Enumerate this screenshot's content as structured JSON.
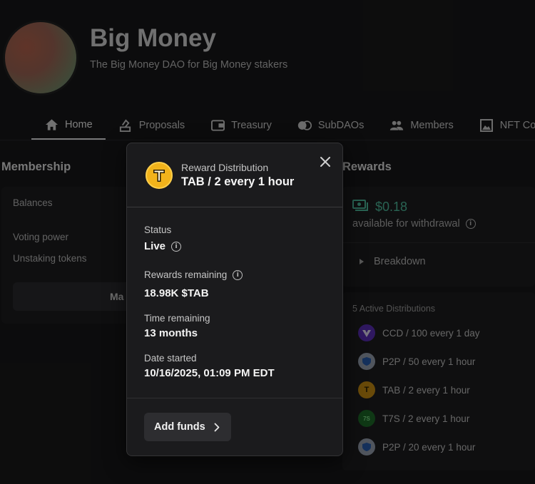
{
  "dao": {
    "name": "Big Money",
    "description": "The Big Money DAO for Big Money stakers"
  },
  "nav": {
    "items": [
      {
        "label": "Home",
        "icon": "home-icon",
        "active": true
      },
      {
        "label": "Proposals",
        "icon": "proposals-icon"
      },
      {
        "label": "Treasury",
        "icon": "treasury-icon"
      },
      {
        "label": "SubDAOs",
        "icon": "subdaos-icon"
      },
      {
        "label": "Members",
        "icon": "members-icon"
      },
      {
        "label": "NFT Colle",
        "icon": "image-icon"
      }
    ]
  },
  "membership": {
    "title": "Membership",
    "balances_label": "Balances",
    "voting_power_label": "Voting power",
    "unstaking_label": "Unstaking tokens",
    "manage_button": "Ma"
  },
  "rewards": {
    "title": "Rewards",
    "amount": "$0.18",
    "available_label": "available for withdrawal",
    "breakdown_label": "Breakdown"
  },
  "distributions": {
    "header": "5 Active Distributions",
    "items": [
      {
        "label": "CCD / 100 every 1 day",
        "color": "#5b2fb8"
      },
      {
        "label": "P2P / 50 every 1 hour",
        "color": "#9aa3b3"
      },
      {
        "label": "TAB / 2 every 1 hour",
        "color": "#c98f12"
      },
      {
        "label": "T7S / 2 every 1 hour",
        "color": "#1e6b2a"
      },
      {
        "label": "P2P / 20 every 1 hour",
        "color": "#9aa3b3"
      }
    ]
  },
  "modal": {
    "kicker": "Reward Distribution",
    "title": "TAB / 2 every 1 hour",
    "token_icon": "tab-token-icon",
    "status_label": "Status",
    "status_value": "Live",
    "rewards_remaining_label": "Rewards remaining",
    "rewards_remaining_value": "18.98K $TAB",
    "time_remaining_label": "Time remaining",
    "time_remaining_value": "13 months",
    "date_started_label": "Date started",
    "date_started_value": "10/16/2025, 01:09 PM EDT",
    "add_funds_label": "Add funds"
  }
}
